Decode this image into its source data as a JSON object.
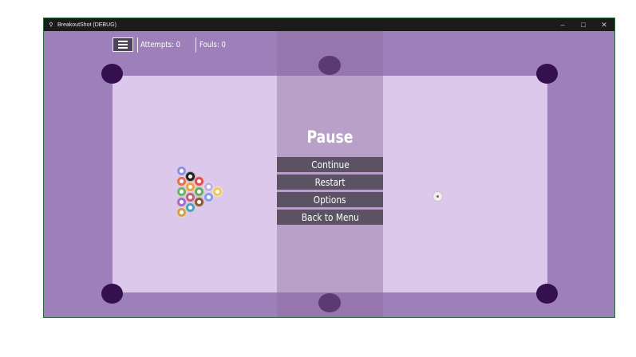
{
  "window": {
    "title": "BreakoutShot (DEBUG)",
    "app_icon": "pool-cue-icon",
    "controls": {
      "minimize": "–",
      "maximize": "□",
      "close": "✕"
    }
  },
  "hud": {
    "menu_icon": "hamburger-menu-icon",
    "attempts_label": "Attempts: 0",
    "fouls_label": "Fouls: 0"
  },
  "pause_menu": {
    "title": "Pause",
    "buttons": [
      "Continue",
      "Restart",
      "Options",
      "Back to Menu"
    ]
  },
  "colors": {
    "felt": "#dcc8ea",
    "rail": "#9d7fba",
    "pocket": "#34104f",
    "button": "#5b5263",
    "ball_colors": [
      "#f0c85a",
      "#c0b0e0",
      "#8a9de0",
      "#e05050",
      "#6aaa6a",
      "#8a5a3a",
      "#202020",
      "#f0a040",
      "#c06080",
      "#50a0c0",
      "#9090e0",
      "#e07060",
      "#70b070",
      "#a070c0",
      "#d0a050"
    ]
  }
}
